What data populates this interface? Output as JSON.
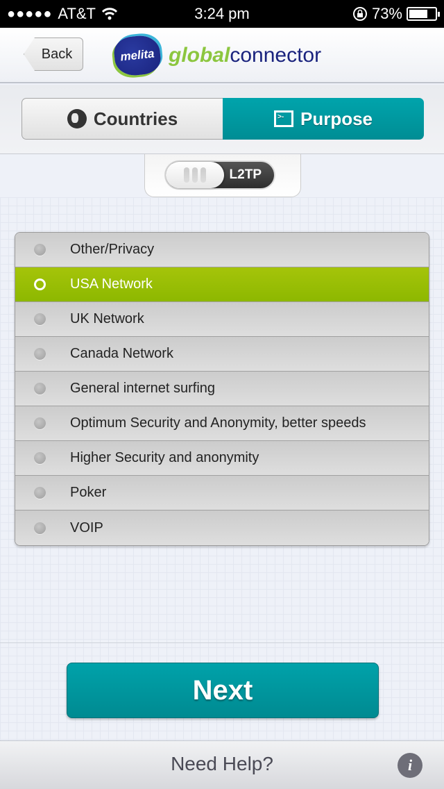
{
  "status_bar": {
    "signal_dots": "●●●●●",
    "carrier": "AT&T",
    "wifi_icon": "wifi-icon",
    "time": "3:24 pm",
    "rotation_lock_icon": "rotation-lock-icon",
    "battery_percent": "73%",
    "battery_level": 0.73
  },
  "navbar": {
    "back_label": "Back",
    "logo_mark": "melita",
    "logo_global": "global",
    "logo_connector": "connector"
  },
  "segmented_control": {
    "tabs": [
      {
        "label": "Countries",
        "icon": "globe-icon",
        "selected": false
      },
      {
        "label": "Purpose",
        "icon": "terminal-icon",
        "selected": true
      }
    ]
  },
  "protocol_toggle": {
    "label": "L2TP"
  },
  "purpose_list": {
    "items": [
      {
        "label": "Other/Privacy",
        "selected": false
      },
      {
        "label": "USA Network",
        "selected": true
      },
      {
        "label": "UK Network",
        "selected": false
      },
      {
        "label": "Canada Network",
        "selected": false
      },
      {
        "label": "General internet surfing",
        "selected": false
      },
      {
        "label": "Optimum Security and Anonymity, better speeds",
        "selected": false
      },
      {
        "label": "Higher Security and anonymity",
        "selected": false
      },
      {
        "label": "Poker",
        "selected": false
      },
      {
        "label": "VOIP",
        "selected": false
      }
    ]
  },
  "actions": {
    "next_label": "Next"
  },
  "footer": {
    "help_label": "Need Help?",
    "info_glyph": "i"
  },
  "colors": {
    "accent_teal": "#00999f",
    "selected_green": "#9bbe05",
    "logo_green": "#8cc63f",
    "logo_navy": "#1a237e"
  }
}
